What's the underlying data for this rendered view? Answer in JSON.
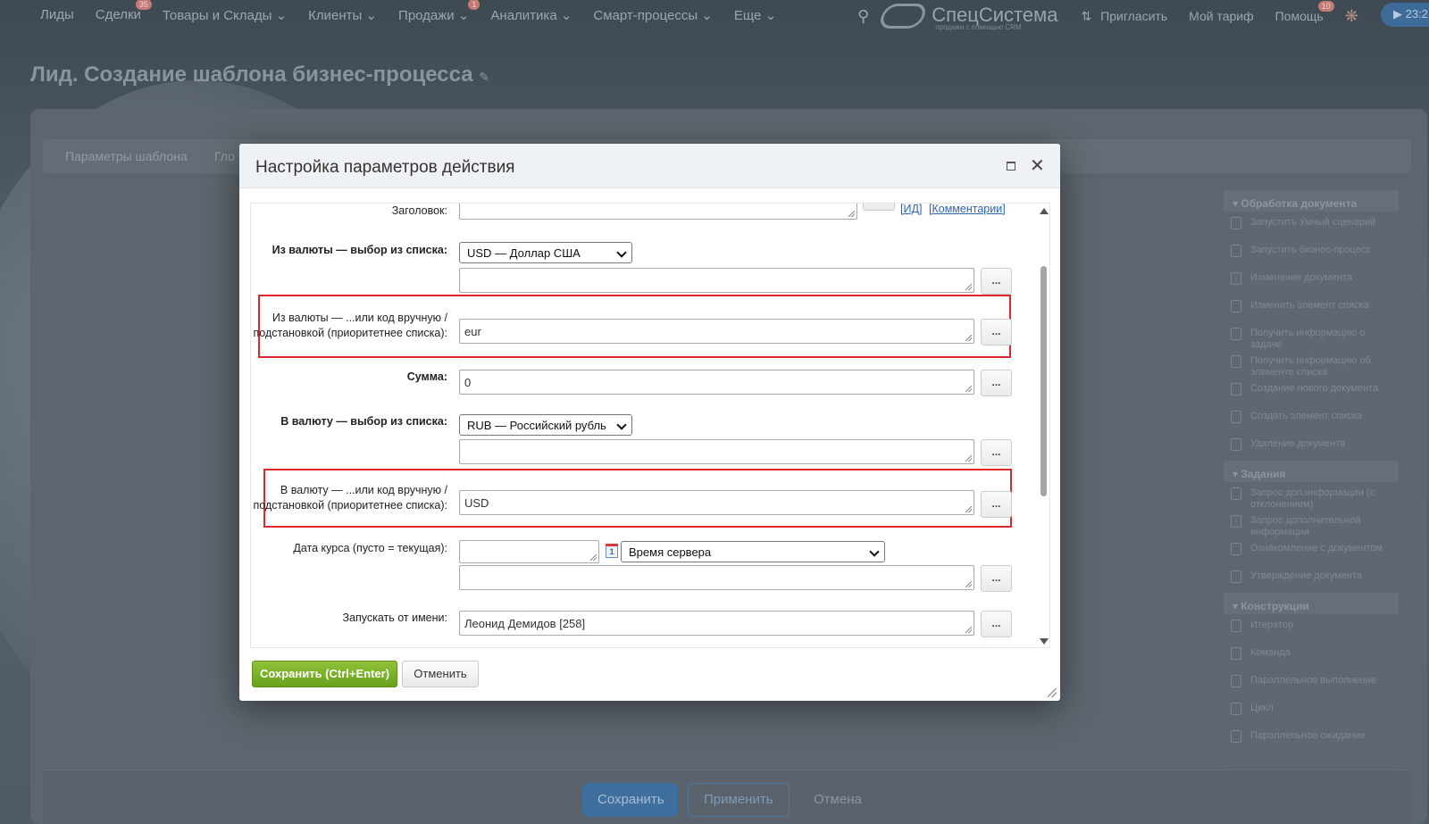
{
  "topnav": {
    "items": [
      {
        "label": "Лиды",
        "badge": ""
      },
      {
        "label": "Сделки",
        "badge": "35"
      },
      {
        "label": "Товары и Склады ⌄",
        "badge": ""
      },
      {
        "label": "Клиенты ⌄",
        "badge": ""
      },
      {
        "label": "Продажи ⌄",
        "badge": "1"
      },
      {
        "label": "Аналитика ⌄",
        "badge": ""
      },
      {
        "label": "Смарт-процессы ⌄",
        "badge": ""
      },
      {
        "label": "Еще ⌄",
        "badge": ""
      }
    ],
    "search_icon": "search-icon",
    "logo_text": "СпецСистема",
    "logo_sub": "продажи с помощью CRM",
    "invite": "Пригласить",
    "tariff": "Мой тариф",
    "help": "Помощь",
    "help_badge": "10",
    "time": "▶ 23:2"
  },
  "page": {
    "title": "Лид. Создание шаблона бизнес-процесса",
    "tab_params": "Параметры шаблона",
    "tab_global": "Гло"
  },
  "sidebar": {
    "group1": "Обработка документа",
    "group1_items": [
      "Запустить Умный сценарий",
      "Запустить бизнес-процесс",
      "Изменение документа",
      "Изменить элемент списка",
      "Получить информацию о задаче",
      "Получить информацию об элементе списка",
      "Создание нового документа",
      "Создать элемент списка",
      "Удаление документа"
    ],
    "group2": "Задания",
    "group2_items": [
      "Запрос доп.информации (с отклонением)",
      "Запрос дополнительной информации",
      "Ознакомление с документом",
      "Утверждение документа"
    ],
    "group3": "Конструкции",
    "group3_items": [
      "Итератор",
      "Команда",
      "Параллельное выполнение",
      "Цикл",
      "Параллельное ожидание"
    ]
  },
  "bottom": {
    "save": "Сохранить",
    "apply": "Применить",
    "cancel": "Отмена"
  },
  "modal": {
    "title": "Настройка параметров действия",
    "fields": {
      "title_label": "Заголовок:",
      "link_id": "ИД",
      "link_comments": "Комментарии",
      "from_list_label": "Из валюты — выбор из списка:",
      "from_list_value": "USD — Доллар США",
      "from_manual_label": "Из валюты — ...или код вручную / подстановкой (приоритетнее списка):",
      "from_manual_value": "eur",
      "amount_label": "Сумма:",
      "amount_value": "0",
      "to_list_label": "В валюту — выбор из списка:",
      "to_list_value": "RUB — Российский рубль",
      "to_manual_label": "В валюту — ...или код вручную / подстановкой (приоритетнее списка):",
      "to_manual_value": "USD",
      "date_label": "Дата курса (пусто = текущая):",
      "date_value": "",
      "time_select": "Время сервера",
      "run_as_label": "Запускать от имени:",
      "run_as_value": "Леонид Демидов [258]",
      "dots": "..."
    },
    "save_btn": "Сохранить (Ctrl+Enter)",
    "cancel_btn": "Отменить"
  }
}
